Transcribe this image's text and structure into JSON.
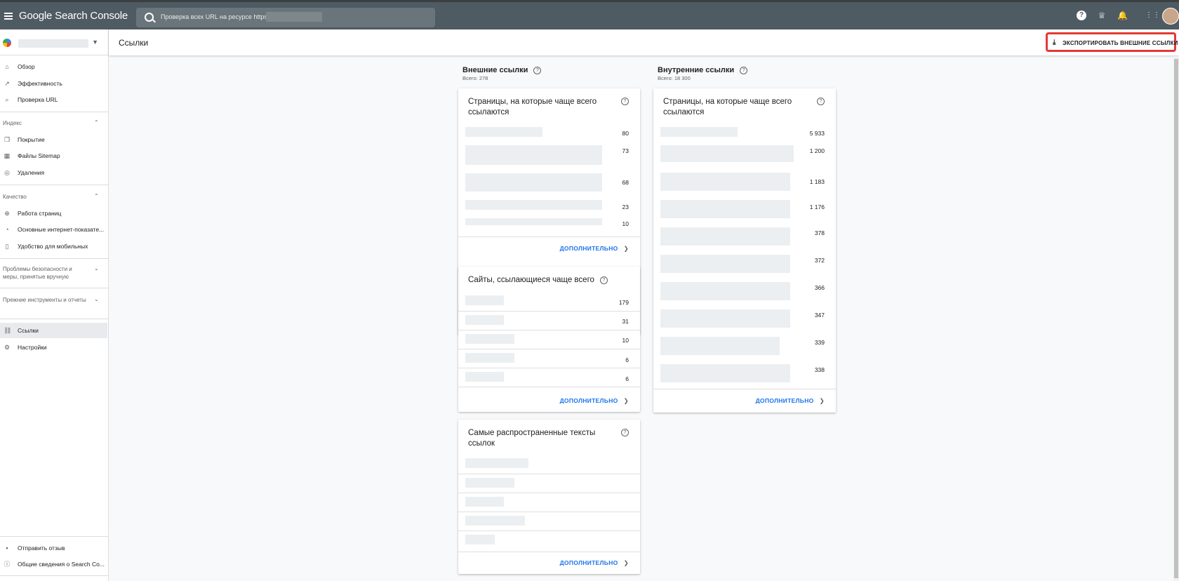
{
  "app": {
    "title": "Google Search Console"
  },
  "search": {
    "placeholder": "Проверка всех URL на ресурсе https"
  },
  "icons": {
    "help": "?",
    "people": "people-icon",
    "bell": "bell-icon",
    "apps": "apps-icon"
  },
  "sidebar": {
    "items_top": [
      {
        "label": "Обзор",
        "icon": "⌂"
      },
      {
        "label": "Эффективность",
        "icon": "↗"
      },
      {
        "label": "Проверка URL",
        "icon": "⌕"
      }
    ],
    "section_index": "Индекс",
    "items_index": [
      {
        "label": "Покрытие",
        "icon": "❐"
      },
      {
        "label": "Файлы Sitemap",
        "icon": "▦"
      },
      {
        "label": "Удаления",
        "icon": "◎"
      }
    ],
    "section_quality": "Качество",
    "items_quality": [
      {
        "label": "Работа страниц",
        "icon": "⊕"
      },
      {
        "label": "Основные интернет-показате...",
        "icon": "◔"
      },
      {
        "label": "Удобство для мобильных",
        "icon": "▯"
      }
    ],
    "section_security": "Проблемы безопасности и меры, принятые вручную",
    "section_legacy": "Прежние инструменты и отчеты",
    "items_bottom": [
      {
        "label": "Ссылки",
        "icon": "⛓"
      },
      {
        "label": "Настройки",
        "icon": "⚙"
      }
    ],
    "footer": [
      {
        "label": "Отправить отзыв",
        "icon": "▪"
      },
      {
        "label": "Общие сведения о Search Co...",
        "icon": "ⓘ"
      }
    ]
  },
  "header": {
    "title": "Ссылки",
    "export_label": "ЭКСПОРТИРОВАТЬ ВНЕШНИЕ ССЫЛКИ"
  },
  "external": {
    "title": "Внешние ссылки",
    "total": "Всего: 278",
    "top_pages": {
      "title": "Страницы, на которые чаще всего ссылаются",
      "values": [
        "80",
        "73",
        "68",
        "23",
        "10"
      ],
      "more": "ДОПОЛНИТЕЛЬНО"
    },
    "top_sites": {
      "title": "Сайты, ссылающиеся чаще всего",
      "values": [
        "179",
        "31",
        "10",
        "6",
        "6"
      ],
      "more": "ДОПОЛНИТЕЛЬНО"
    },
    "top_texts": {
      "title": "Самые распространенные тексты ссылок",
      "more": "ДОПОЛНИТЕЛЬНО"
    }
  },
  "internal": {
    "title": "Внутренние ссылки",
    "total": "Всего: 18 300",
    "top_pages": {
      "title": "Страницы, на которые чаще всего ссылаются",
      "values": [
        "5 933",
        "1 200",
        "1 183",
        "1 176",
        "378",
        "372",
        "366",
        "347",
        "339",
        "338"
      ],
      "more": "ДОПОЛНИТЕЛЬНО"
    }
  }
}
